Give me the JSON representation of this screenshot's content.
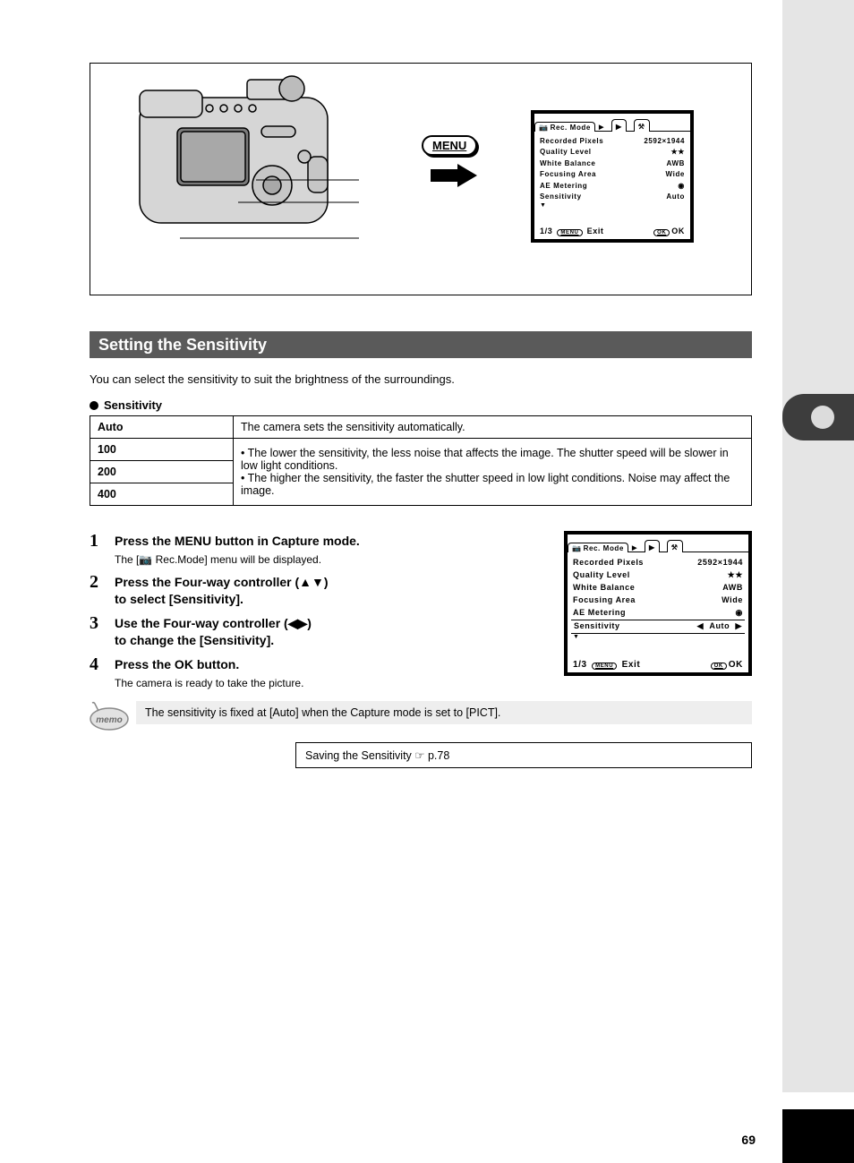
{
  "page_number": "69",
  "section_title": "Setting the Sensitivity",
  "intro_text": "You can select the sensitivity to suit the brightness of the surroundings.",
  "bullet_label": "Sensitivity",
  "iso_table": {
    "r0k": "Auto",
    "r0v": "The camera sets the sensitivity automatically.",
    "r1k": "100",
    "r2k": "200",
    "r3k": "400",
    "rmerged_l1": "• The lower the sensitivity, the less noise that affects the image. The shutter speed will be slower in low light conditions.",
    "rmerged_l2": "• The higher the sensitivity, the faster the shutter speed in low light conditions. Noise may affect the image."
  },
  "steps": {
    "s1": "Press the MENU button in Capture mode.",
    "s1_sub": "The [📷 Rec.Mode] menu will be displayed.",
    "s2_l1": "Press the Four-way controller (▲▼)",
    "s2_l2": "to select [Sensitivity].",
    "s3_l1": "Use the Four-way controller (◀▶)",
    "s3_l2": "to change the [Sensitivity].",
    "s4": "Press the OK button.",
    "s4_sub": "The camera is ready to take the picture."
  },
  "memo": "The sensitivity is fixed at [Auto] when the Capture mode is set to [PICT].",
  "save_box": "Saving the Sensitivity ☞ p.78",
  "lcd": {
    "tab_label": "Rec. Mode",
    "row1k": "Recorded Pixels",
    "row1v": "2592×1944",
    "row2k": "Quality Level",
    "row2v": "★★",
    "row3k": "White Balance",
    "row3v": "AWB",
    "row4k": "Focusing Area",
    "row4v": "Wide",
    "row5k": "AE Metering",
    "row5v_icon": "spot-icon",
    "row6k": "Sensitivity",
    "row6v": "Auto",
    "page": "1/3",
    "exit": "Exit",
    "ok": "OK",
    "menu_pill": "MENU"
  }
}
